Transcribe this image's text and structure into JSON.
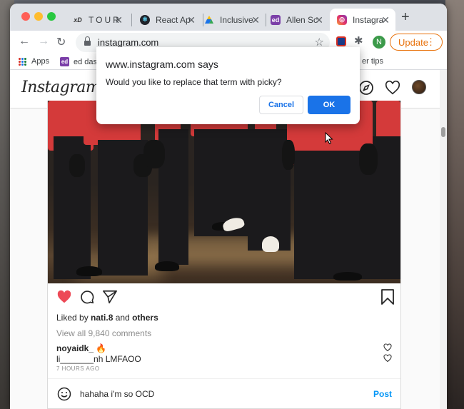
{
  "browser": {
    "tabs": [
      {
        "label": "TOUR",
        "icon": "tour-icon",
        "active": false
      },
      {
        "label": "React Ap",
        "icon": "react-icon",
        "active": false
      },
      {
        "label": "Inclusive",
        "icon": "google-drive-icon",
        "active": false
      },
      {
        "label": "Allen Sc",
        "icon": "ed-icon",
        "active": false
      },
      {
        "label": "Instagra",
        "icon": "instagram-icon",
        "active": true
      }
    ],
    "url": "instagram.com",
    "profile_initial": "N",
    "update_label": "Update",
    "bookmarks": [
      {
        "label": "Apps",
        "icon": "apps-grid-icon"
      },
      {
        "label": "ed das",
        "icon": "ed-icon"
      },
      {
        "label": "er tips",
        "icon": ""
      }
    ]
  },
  "instagram": {
    "logo": "Instagram",
    "post": {
      "liked_by_prefix": "Liked by ",
      "liked_by_user": "nati.8",
      "liked_by_and": " and ",
      "liked_by_others": "others",
      "view_all": "View all 9,840 comments",
      "comments": [
        {
          "user": "noyaidk_",
          "text": "🔥"
        },
        {
          "user": "",
          "text": "li_______nh LMFAOO"
        }
      ],
      "time": "7 HOURS AGO",
      "comment_input": "hahaha i'm so OCD",
      "post_label": "Post"
    }
  },
  "dialog": {
    "title": "www.instagram.com says",
    "message": "Would you like to replace that term with picky?",
    "cancel_label": "Cancel",
    "ok_label": "OK"
  },
  "colors": {
    "accent": "#1a73e8",
    "update": "#e8710a",
    "like_heart": "#ed4956",
    "jacket": "#d43a3a"
  }
}
